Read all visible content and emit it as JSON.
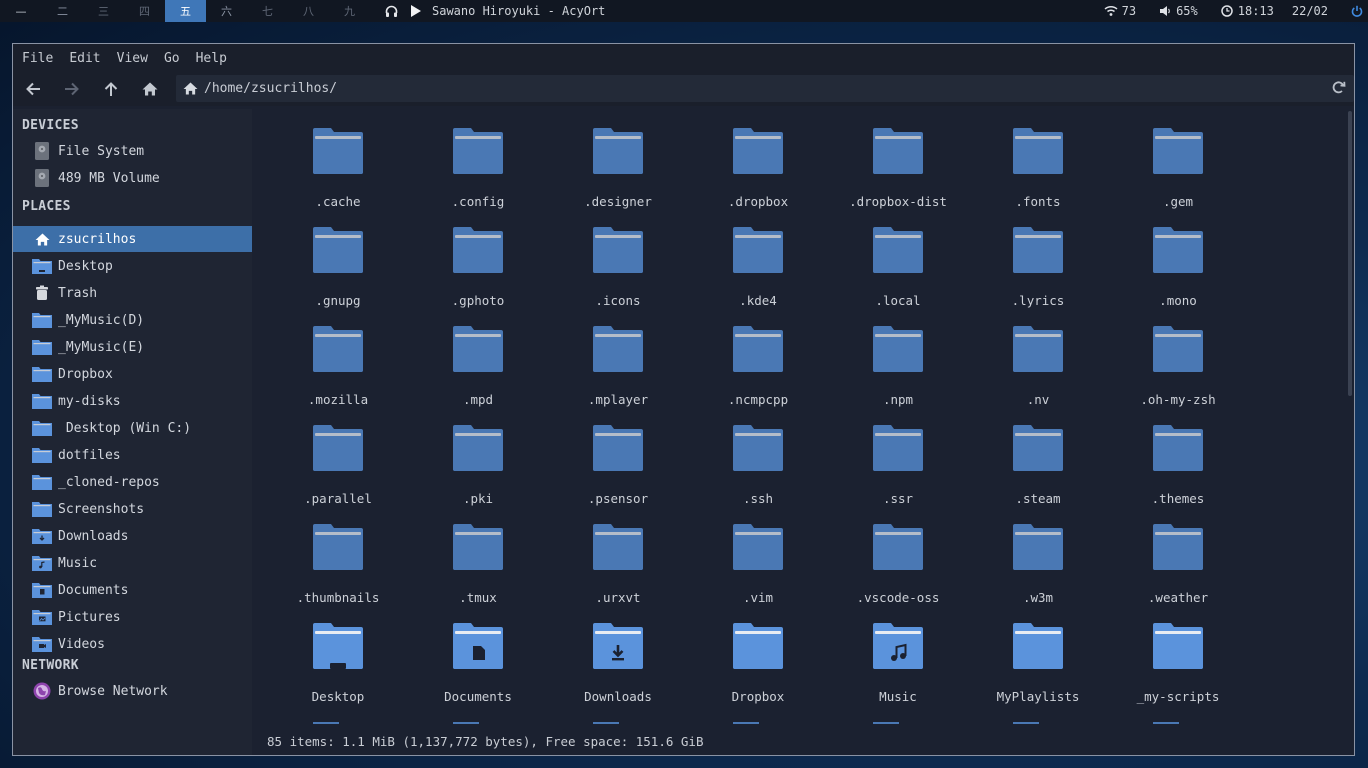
{
  "panel": {
    "workspaces": [
      "一",
      "二",
      "三",
      "四",
      "五",
      "六",
      "七",
      "八",
      "九"
    ],
    "active_workspace": 4,
    "now_playing": "Sawano Hiroyuki - AcyOrt",
    "wifi": "73",
    "volume": "65%",
    "time": "18:13",
    "date": "22/02"
  },
  "menubar": [
    "File",
    "Edit",
    "View",
    "Go",
    "Help"
  ],
  "path": "/home/zsucrilhos/",
  "sidebar": {
    "devices_header": "DEVICES",
    "devices": [
      "File System",
      "489 MB Volume"
    ],
    "places_header": "PLACES",
    "places": [
      {
        "label": "zsucrilhos",
        "icon": "home-icon"
      },
      {
        "label": "Desktop",
        "icon": "desktop-folder-icon"
      },
      {
        "label": "Trash",
        "icon": "trash-icon"
      },
      {
        "label": "_MyMusic(D)",
        "icon": "folder-icon"
      },
      {
        "label": "_MyMusic(E)",
        "icon": "folder-icon"
      },
      {
        "label": "Dropbox",
        "icon": "folder-icon"
      },
      {
        "label": "my-disks",
        "icon": "folder-icon"
      },
      {
        "label": " Desktop (Win C:)",
        "icon": "folder-icon"
      },
      {
        "label": "dotfiles",
        "icon": "folder-icon"
      },
      {
        "label": "_cloned-repos",
        "icon": "folder-icon"
      },
      {
        "label": "Screenshots",
        "icon": "folder-icon"
      },
      {
        "label": "Downloads",
        "icon": "downloads-folder-icon"
      },
      {
        "label": "Music",
        "icon": "music-folder-icon"
      },
      {
        "label": "Documents",
        "icon": "documents-folder-icon"
      },
      {
        "label": "Pictures",
        "icon": "pictures-folder-icon"
      },
      {
        "label": "Videos",
        "icon": "videos-folder-icon"
      }
    ],
    "network_header": "NETWORK",
    "network": [
      "Browse Network"
    ]
  },
  "files": [
    {
      "name": ".cache",
      "kind": "plain"
    },
    {
      "name": ".config",
      "kind": "plain"
    },
    {
      "name": ".designer",
      "kind": "plain"
    },
    {
      "name": ".dropbox",
      "kind": "plain"
    },
    {
      "name": ".dropbox-dist",
      "kind": "plain"
    },
    {
      "name": ".fonts",
      "kind": "plain"
    },
    {
      "name": ".gem",
      "kind": "plain"
    },
    {
      "name": ".gnupg",
      "kind": "plain"
    },
    {
      "name": ".gphoto",
      "kind": "plain"
    },
    {
      "name": ".icons",
      "kind": "plain"
    },
    {
      "name": ".kde4",
      "kind": "plain"
    },
    {
      "name": ".local",
      "kind": "plain"
    },
    {
      "name": ".lyrics",
      "kind": "plain"
    },
    {
      "name": ".mono",
      "kind": "plain"
    },
    {
      "name": ".mozilla",
      "kind": "plain"
    },
    {
      "name": ".mpd",
      "kind": "plain"
    },
    {
      "name": ".mplayer",
      "kind": "plain"
    },
    {
      "name": ".ncmpcpp",
      "kind": "plain"
    },
    {
      "name": ".npm",
      "kind": "plain"
    },
    {
      "name": ".nv",
      "kind": "plain"
    },
    {
      "name": ".oh-my-zsh",
      "kind": "plain"
    },
    {
      "name": ".parallel",
      "kind": "plain"
    },
    {
      "name": ".pki",
      "kind": "plain"
    },
    {
      "name": ".psensor",
      "kind": "plain"
    },
    {
      "name": ".ssh",
      "kind": "plain"
    },
    {
      "name": ".ssr",
      "kind": "plain"
    },
    {
      "name": ".steam",
      "kind": "plain"
    },
    {
      "name": ".themes",
      "kind": "plain"
    },
    {
      "name": ".thumbnails",
      "kind": "plain"
    },
    {
      "name": ".tmux",
      "kind": "plain"
    },
    {
      "name": ".urxvt",
      "kind": "plain"
    },
    {
      "name": ".vim",
      "kind": "plain"
    },
    {
      "name": ".vscode-oss",
      "kind": "plain"
    },
    {
      "name": ".w3m",
      "kind": "plain"
    },
    {
      "name": ".weather",
      "kind": "plain"
    },
    {
      "name": "Desktop",
      "kind": "desktop"
    },
    {
      "name": "Documents",
      "kind": "documents"
    },
    {
      "name": "Downloads",
      "kind": "downloads"
    },
    {
      "name": "Dropbox",
      "kind": "bright"
    },
    {
      "name": "Music",
      "kind": "music"
    },
    {
      "name": "MyPlaylists",
      "kind": "bright"
    },
    {
      "name": "_my-scripts",
      "kind": "bright"
    }
  ],
  "status": "85 items: 1.1 MiB (1,137,772 bytes), Free space: 151.6 GiB",
  "colors": {
    "accent": "#3d6fa8",
    "folder_dark": "#4a78b4",
    "folder_bright": "#5b93dc",
    "folder_tab": "#b5bdc9"
  }
}
